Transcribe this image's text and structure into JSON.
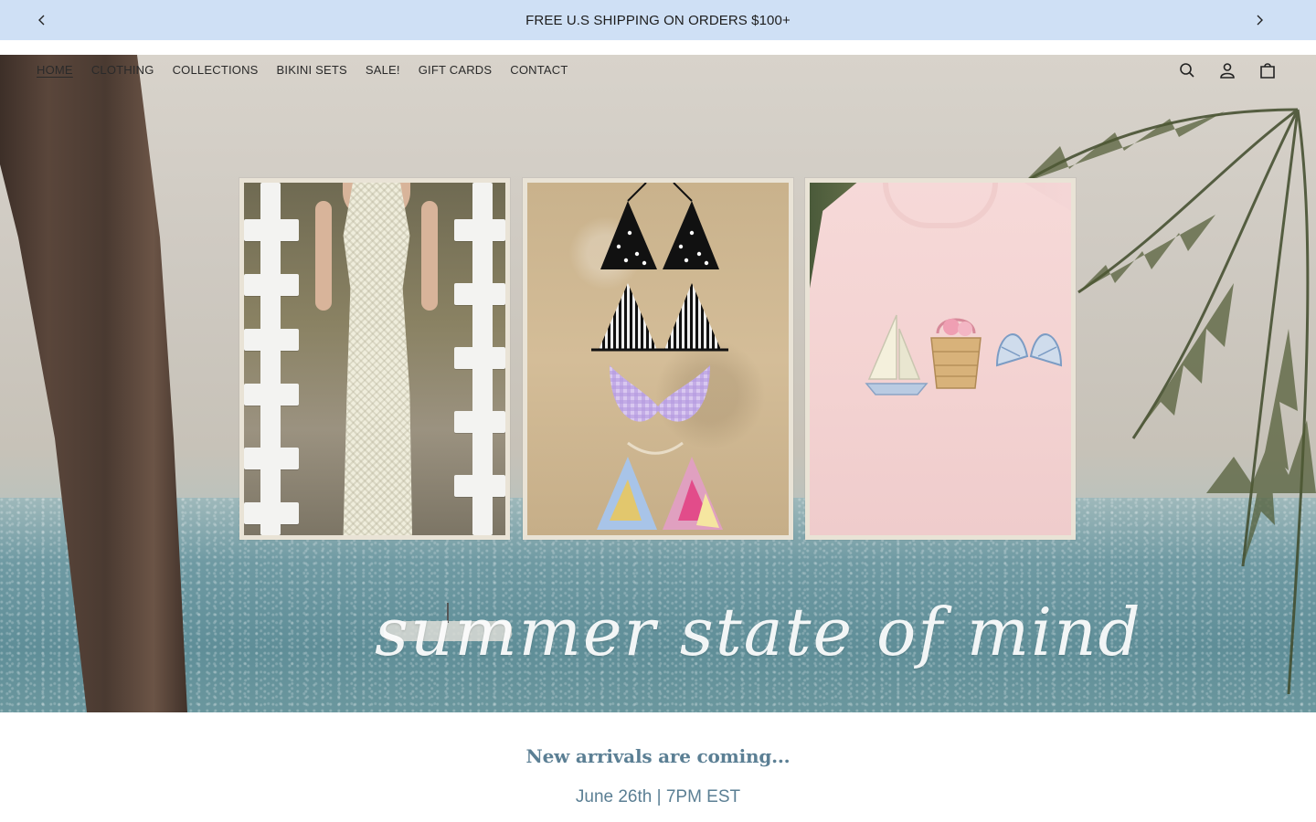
{
  "announcement": {
    "text": "FREE U.S SHIPPING ON ORDERS $100+",
    "prev_icon": "chevron-left-icon",
    "next_icon": "chevron-right-icon",
    "background_color": "#cfe0f5"
  },
  "nav": {
    "links": [
      {
        "label": "HOME",
        "active": true
      },
      {
        "label": "CLOTHING",
        "active": false
      },
      {
        "label": "COLLECTIONS",
        "active": false
      },
      {
        "label": "BIKINI SETS",
        "active": false
      },
      {
        "label": "SALE!",
        "active": false
      },
      {
        "label": "GIFT CARDS",
        "active": false
      },
      {
        "label": "CONTACT",
        "active": false
      }
    ],
    "icons": [
      "search-icon",
      "account-icon",
      "cart-icon"
    ]
  },
  "hero": {
    "script_text": "summer state of mind",
    "panels": [
      "crochet-dress-photo",
      "bikini-tops-on-sand-photo",
      "embroidered-pink-tee-photo"
    ]
  },
  "promo": {
    "headline": "New arrivals are coming...",
    "subline": "June 26th | 7PM EST",
    "text_color": "#5b7f94"
  }
}
